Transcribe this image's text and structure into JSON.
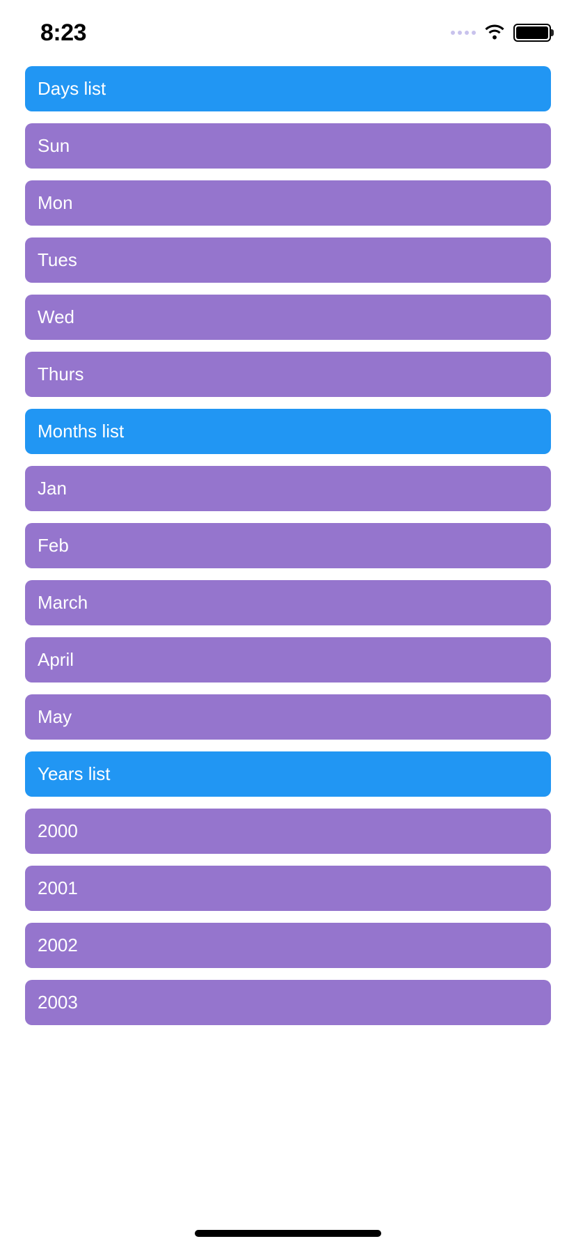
{
  "statusBar": {
    "time": "8:23"
  },
  "sections": [
    {
      "title": "Days list",
      "items": [
        "Sun",
        "Mon",
        "Tues",
        "Wed",
        "Thurs"
      ]
    },
    {
      "title": "Months list",
      "items": [
        "Jan",
        "Feb",
        "March",
        "April",
        "May"
      ]
    },
    {
      "title": "Years list",
      "items": [
        "2000",
        "2001",
        "2002",
        "2003"
      ]
    }
  ]
}
